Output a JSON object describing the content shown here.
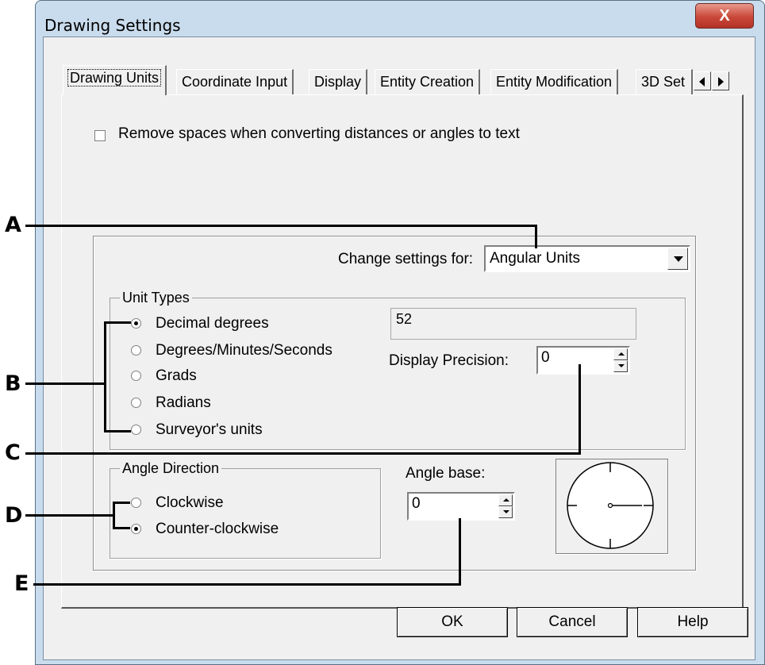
{
  "window": {
    "title": "Drawing Settings",
    "close_glyph": "X"
  },
  "tabs": [
    "Drawing Units",
    "Coordinate Input",
    "Display",
    "Entity Creation",
    "Entity Modification",
    "3D Set"
  ],
  "remove_spaces": {
    "label": "Remove spaces when converting distances or angles to text",
    "checked": false
  },
  "change_settings": {
    "label": "Change settings for:",
    "value": "Angular Units"
  },
  "unit_types": {
    "legend": "Unit Types",
    "options": [
      "Decimal degrees",
      "Degrees/Minutes/Seconds",
      "Grads",
      "Radians",
      "Surveyor's units"
    ],
    "selected": "Decimal degrees",
    "sample": "52"
  },
  "precision": {
    "label": "Display Precision:",
    "value": "0"
  },
  "angle_direction": {
    "legend": "Angle Direction",
    "options": [
      "Clockwise",
      "Counter-clockwise"
    ],
    "selected": "Counter-clockwise"
  },
  "angle_base": {
    "label": "Angle base:",
    "value": "0"
  },
  "buttons": {
    "ok": "OK",
    "cancel": "Cancel",
    "help": "Help"
  },
  "callouts": [
    "A",
    "B",
    "C",
    "D",
    "E"
  ]
}
